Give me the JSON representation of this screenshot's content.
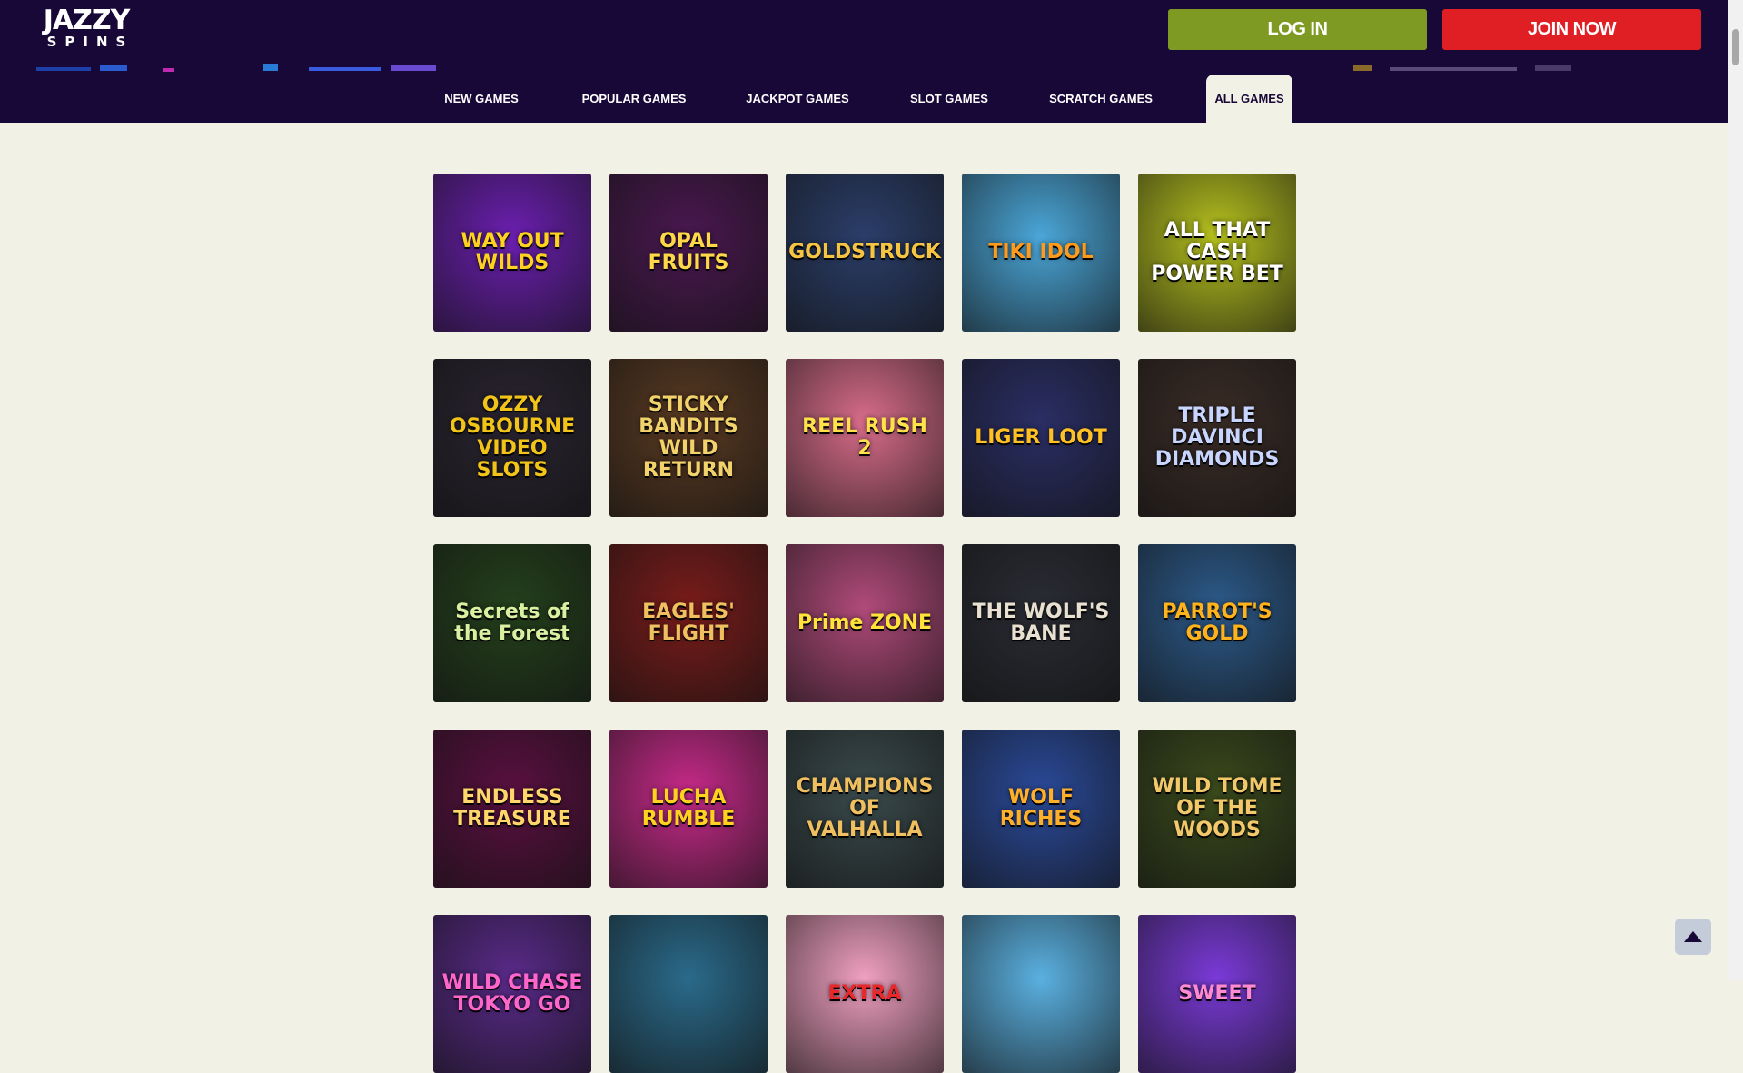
{
  "brand": {
    "line1": "JAZZY",
    "line2": "SPINS"
  },
  "header": {
    "login_label": "LOG IN",
    "join_label": "JOIN NOW"
  },
  "nav": {
    "items": [
      {
        "label": "NEW GAMES",
        "active": false
      },
      {
        "label": "POPULAR GAMES",
        "active": false
      },
      {
        "label": "JACKPOT GAMES",
        "active": false
      },
      {
        "label": "SLOT GAMES",
        "active": false
      },
      {
        "label": "SCRATCH GAMES",
        "active": false
      },
      {
        "label": "ALL GAMES",
        "active": true
      }
    ]
  },
  "games": [
    {
      "title": "WAY OUT WILDS",
      "bg": "#6b1fb0",
      "fg": "#ffd21f"
    },
    {
      "title": "OPAL FRUITS",
      "bg": "#4a1850",
      "fg": "#ffd84a"
    },
    {
      "title": "GOLDSTRUCK",
      "bg": "#2b3e6a",
      "fg": "#f5c443"
    },
    {
      "title": "TIKI IDOL",
      "bg": "#4aa6d8",
      "fg": "#ff9a1a"
    },
    {
      "title": "ALL THAT CASH POWER BET",
      "bg": "#b7c21e",
      "fg": "#ffffff"
    },
    {
      "title": "OZZY OSBOURNE VIDEO SLOTS",
      "bg": "#2a2430",
      "fg": "#f2c41a"
    },
    {
      "title": "STICKY BANDITS WILD RETURN",
      "bg": "#5a3a22",
      "fg": "#f2d26a"
    },
    {
      "title": "REEL RUSH 2",
      "bg": "#d86c8a",
      "fg": "#ffe24a"
    },
    {
      "title": "LIGER LOOT",
      "bg": "#2a2e64",
      "fg": "#ffc024"
    },
    {
      "title": "TRIPLE DAVINCI DIAMONDS",
      "bg": "#3a2c26",
      "fg": "#c8d6ff"
    },
    {
      "title": "Secrets of the Forest",
      "bg": "#24401c",
      "fg": "#d8f0a0"
    },
    {
      "title": "EAGLES' FLIGHT",
      "bg": "#7a1c1a",
      "fg": "#f0c060"
    },
    {
      "title": "Prime ZONE",
      "bg": "#b04a7a",
      "fg": "#ffe23a"
    },
    {
      "title": "THE WOLF'S BANE",
      "bg": "#2a2c34",
      "fg": "#e8e0d0"
    },
    {
      "title": "PARROT'S GOLD",
      "bg": "#2c5a8a",
      "fg": "#ffb21a"
    },
    {
      "title": "ENDLESS TREASURE",
      "bg": "#5a1040",
      "fg": "#ffd66a"
    },
    {
      "title": "LUCHA RUMBLE",
      "bg": "#c82a8a",
      "fg": "#ffd21f"
    },
    {
      "title": "CHAMPIONS OF VALHALLA",
      "bg": "#3a4a4c",
      "fg": "#f0c060"
    },
    {
      "title": "WOLF RICHES",
      "bg": "#2a4a9a",
      "fg": "#ffb02a"
    },
    {
      "title": "WILD TOME OF THE WOODS",
      "bg": "#3a4a1c",
      "fg": "#f2c86a"
    },
    {
      "title": "WILD CHASE TOKYO GO",
      "bg": "#5a2a8a",
      "fg": "#ff66cc"
    },
    {
      "title": "",
      "bg": "#2a6a8a",
      "fg": "#ffffff"
    },
    {
      "title": "EXTRA",
      "bg": "#f0a0c0",
      "fg": "#e8282a"
    },
    {
      "title": "",
      "bg": "#5ab0e0",
      "fg": "#ffffff"
    },
    {
      "title": "SWEET",
      "bg": "#7a3ad8",
      "fg": "#ff8ad0"
    }
  ]
}
